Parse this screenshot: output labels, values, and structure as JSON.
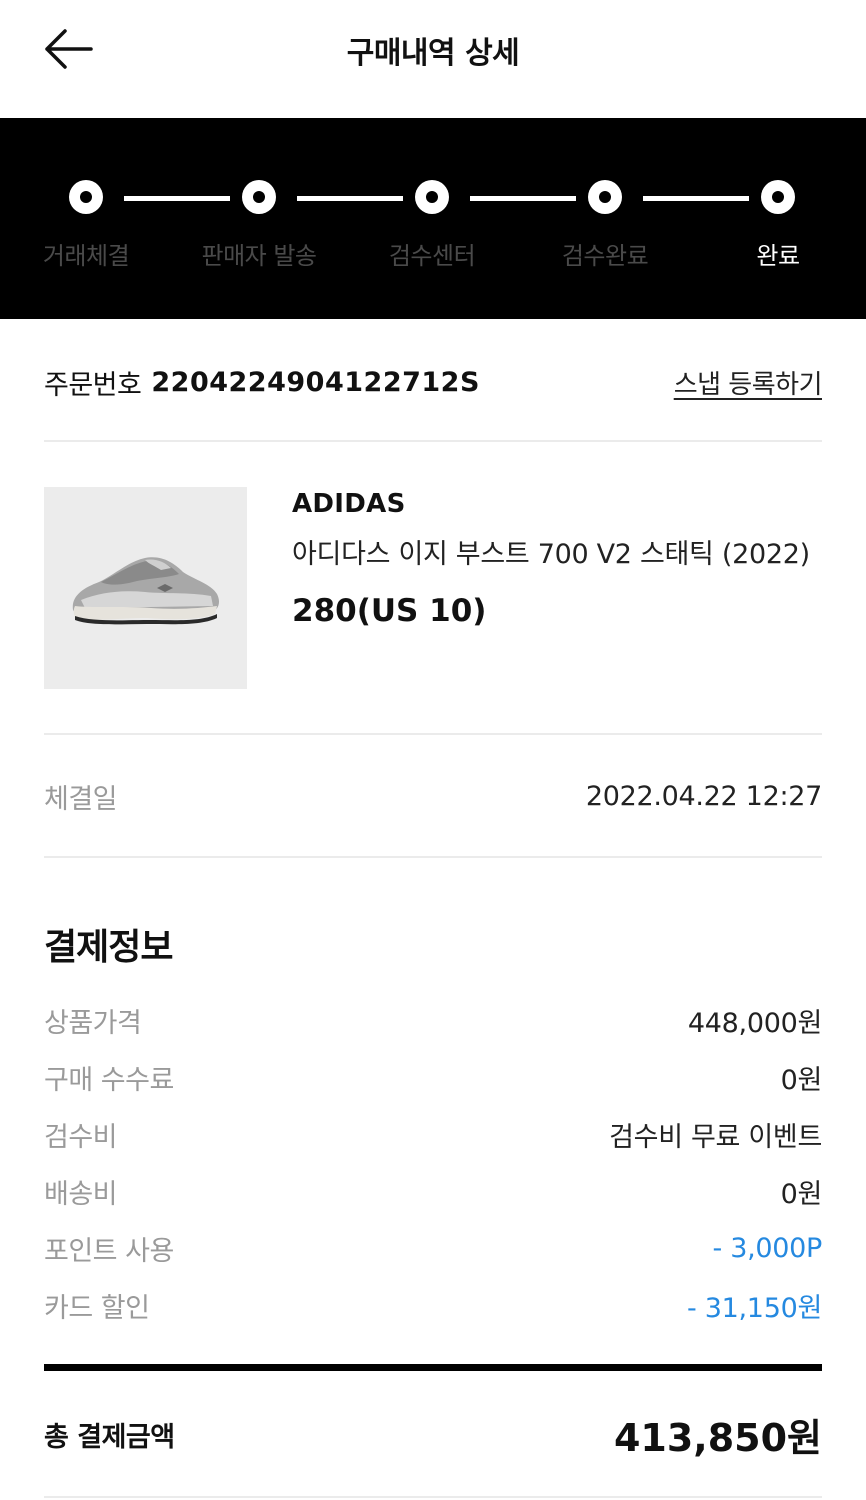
{
  "header": {
    "title": "구매내역 상세",
    "back_icon": "arrow-left-icon"
  },
  "progress": {
    "steps": [
      {
        "label": "거래체결",
        "active": false
      },
      {
        "label": "판매자 발송",
        "active": false
      },
      {
        "label": "검수센터",
        "active": false
      },
      {
        "label": "검수완료",
        "active": false
      },
      {
        "label": "완료",
        "active": true
      }
    ]
  },
  "order": {
    "label": "주문번호",
    "number": "2204224904122712S",
    "snap_link": "스냅 등록하기"
  },
  "product": {
    "brand": "ADIDAS",
    "name": "아디다스 이지 부스트 700 V2 스태틱 (2022)",
    "size": "280(US 10)",
    "image_icon": "sneaker-image"
  },
  "deal": {
    "label": "체결일",
    "value": "2022.04.22 12:27"
  },
  "payment": {
    "title": "결제정보",
    "rows": [
      {
        "label": "상품가격",
        "value": "448,000원",
        "highlight": false
      },
      {
        "label": "구매 수수료",
        "value": "0원",
        "highlight": false
      },
      {
        "label": "검수비",
        "value": "검수비 무료 이벤트",
        "highlight": false
      },
      {
        "label": "배송비",
        "value": "0원",
        "highlight": false
      },
      {
        "label": "포인트 사용",
        "value": "- 3,000P",
        "highlight": true
      },
      {
        "label": "카드 할인",
        "value": "- 31,150원",
        "highlight": true
      }
    ],
    "total_label": "총 결제금액",
    "total_value": "413,850원"
  },
  "colors": {
    "accent_blue": "#2589e0",
    "progress_bg": "#000000",
    "inactive_label": "#4a4a4a"
  }
}
